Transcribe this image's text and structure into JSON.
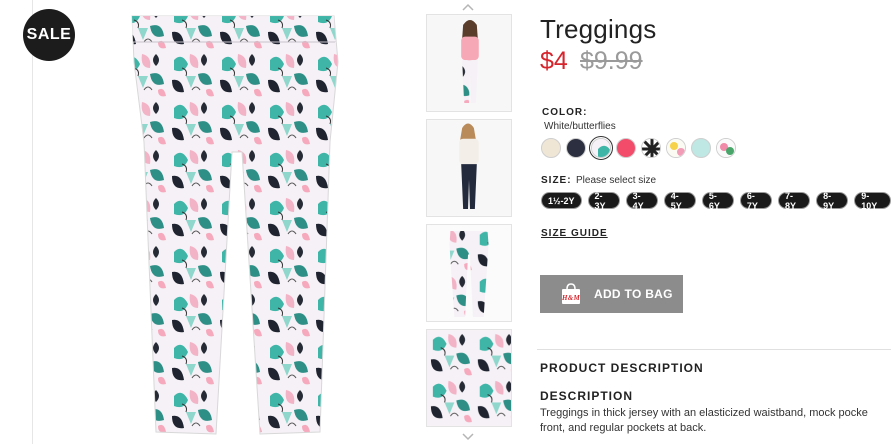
{
  "badge": {
    "label": "SALE"
  },
  "product": {
    "title": "Treggings",
    "price_current": "$4",
    "price_original": "$9.99"
  },
  "color": {
    "label": "COLOR:",
    "selected_value": "White/butterflies",
    "swatches": [
      {
        "name": "beige",
        "color": "#efe6d6"
      },
      {
        "name": "dark-blue",
        "color": "#2b2f3f"
      },
      {
        "name": "white-butterflies",
        "color": "#f4f0f6",
        "selected": true
      },
      {
        "name": "pink",
        "color": "#f24c6a"
      },
      {
        "name": "black-white-pattern",
        "color": "#222222"
      },
      {
        "name": "yellow-floral",
        "color": "#f6e27a"
      },
      {
        "name": "mint",
        "color": "#bfe7e3"
      },
      {
        "name": "floral",
        "color": "#f3c2cf"
      }
    ]
  },
  "size": {
    "label": "SIZE:",
    "hint": "Please select size",
    "options": [
      "1½-2Y",
      "2-3Y",
      "3-4Y",
      "4-5Y",
      "5-6Y",
      "6-7Y",
      "7-8Y",
      "8-9Y",
      "9-10Y"
    ],
    "guide_label": "SIZE GUIDE"
  },
  "actions": {
    "add_to_bag": "ADD TO BAG",
    "bag_logo": "H&M"
  },
  "description": {
    "section_title": "PRODUCT DESCRIPTION",
    "heading": "DESCRIPTION",
    "line1": "Treggings in thick jersey with an elasticized waistband, mock pocke",
    "line2": "front, and regular pockets at back."
  },
  "colors": {
    "sale_red": "#d6242c",
    "button_gray": "#8c8c8c",
    "pill_black": "#1a1a1a"
  }
}
